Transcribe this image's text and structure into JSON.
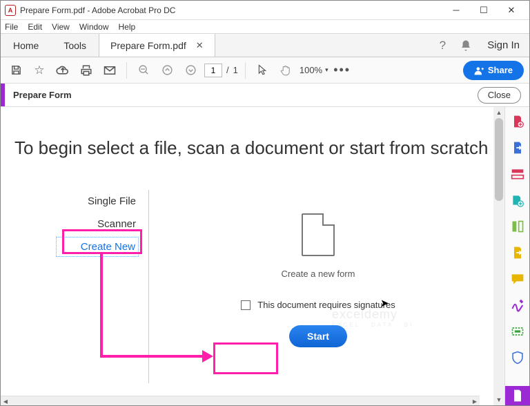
{
  "window": {
    "title": "Prepare Form.pdf - Adobe Acrobat Pro DC",
    "app_icon_letter": "A"
  },
  "menu": [
    "File",
    "Edit",
    "View",
    "Window",
    "Help"
  ],
  "tabs": {
    "home": "Home",
    "tools": "Tools",
    "document": "Prepare Form.pdf",
    "signin": "Sign In"
  },
  "toolbar": {
    "page_current": "1",
    "page_total": "1",
    "zoom": "100%",
    "share": "Share"
  },
  "contextbar": {
    "label": "Prepare Form",
    "close": "Close"
  },
  "content": {
    "heading": "To begin select a file, scan a document or start from scratch",
    "options": {
      "single_file": "Single File",
      "scanner": "Scanner",
      "create_new": "Create New"
    },
    "caption": "Create a new form",
    "sig_label": "This document requires signatures",
    "start": "Start"
  },
  "watermark": {
    "main": "exceldemy",
    "sub": "EXCEL · DATA · BI"
  },
  "rail_icons": [
    "create-pdf",
    "export-pdf",
    "edit-pdf",
    "combine",
    "organize",
    "compress",
    "comment",
    "fill-sign",
    "stamp",
    "protect",
    "more"
  ],
  "rail_colors": [
    "#d9365a",
    "#3b6fd9",
    "#d9365a",
    "#21b4b4",
    "#7bc043",
    "#e8b500",
    "#e8b500",
    "#9b2ad4",
    "#3aa63a",
    "#3b6fd9",
    "#9b2ad4"
  ]
}
